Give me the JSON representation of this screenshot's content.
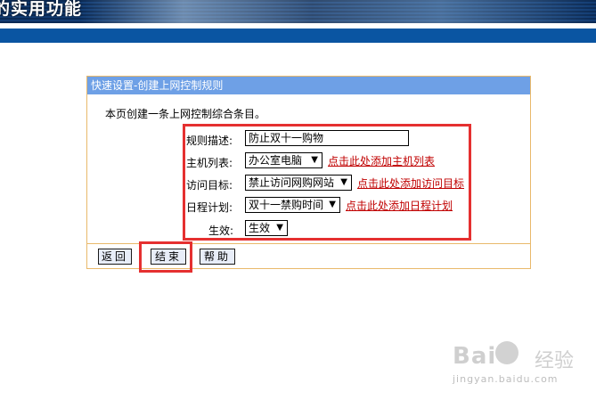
{
  "banner": {
    "title": "的实用功能"
  },
  "panel": {
    "header": "快速设置-创建上网控制规则",
    "intro": "本页创建一条上网控制综合条目。"
  },
  "form": {
    "rule_desc_label": "规则描述:",
    "rule_desc_value": "防止双十一购物",
    "host_label": "主机列表:",
    "host_value": "办公室电脑",
    "host_link": "点击此处添加主机列表",
    "target_label": "访问目标:",
    "target_value": "禁止访问网购网站",
    "target_link": "点击此处添加访问目标",
    "schedule_label": "日程计划:",
    "schedule_value": "双十一禁购时间",
    "schedule_link": "点击此处添加日程计划",
    "effect_label": "生效:",
    "effect_value": "生效"
  },
  "buttons": {
    "back": "返回",
    "finish": "结束",
    "help": "帮助"
  },
  "colors": {
    "panel_header_bg": "#6ea0e6",
    "panel_border": "#e9b96b",
    "link_color": "#c00000",
    "highlight_box": "#e53030",
    "banner_band": "#0a55a2"
  },
  "watermark": {
    "brand": "Bai",
    "brand_cn": "经验",
    "url": "jingyan.baidu.com"
  }
}
